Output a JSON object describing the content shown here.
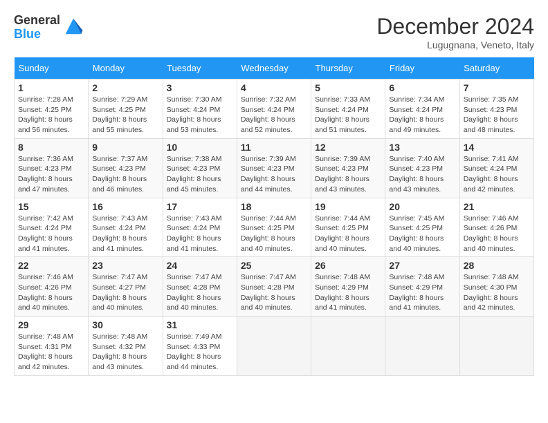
{
  "header": {
    "logo_line1": "General",
    "logo_line2": "Blue",
    "month_title": "December 2024",
    "location": "Lugugnana, Veneto, Italy"
  },
  "columns": [
    "Sunday",
    "Monday",
    "Tuesday",
    "Wednesday",
    "Thursday",
    "Friday",
    "Saturday"
  ],
  "weeks": [
    [
      {
        "day": "1",
        "info": "Sunrise: 7:28 AM\nSunset: 4:25 PM\nDaylight: 8 hours\nand 56 minutes."
      },
      {
        "day": "2",
        "info": "Sunrise: 7:29 AM\nSunset: 4:25 PM\nDaylight: 8 hours\nand 55 minutes."
      },
      {
        "day": "3",
        "info": "Sunrise: 7:30 AM\nSunset: 4:24 PM\nDaylight: 8 hours\nand 53 minutes."
      },
      {
        "day": "4",
        "info": "Sunrise: 7:32 AM\nSunset: 4:24 PM\nDaylight: 8 hours\nand 52 minutes."
      },
      {
        "day": "5",
        "info": "Sunrise: 7:33 AM\nSunset: 4:24 PM\nDaylight: 8 hours\nand 51 minutes."
      },
      {
        "day": "6",
        "info": "Sunrise: 7:34 AM\nSunset: 4:24 PM\nDaylight: 8 hours\nand 49 minutes."
      },
      {
        "day": "7",
        "info": "Sunrise: 7:35 AM\nSunset: 4:23 PM\nDaylight: 8 hours\nand 48 minutes."
      }
    ],
    [
      {
        "day": "8",
        "info": "Sunrise: 7:36 AM\nSunset: 4:23 PM\nDaylight: 8 hours\nand 47 minutes."
      },
      {
        "day": "9",
        "info": "Sunrise: 7:37 AM\nSunset: 4:23 PM\nDaylight: 8 hours\nand 46 minutes."
      },
      {
        "day": "10",
        "info": "Sunrise: 7:38 AM\nSunset: 4:23 PM\nDaylight: 8 hours\nand 45 minutes."
      },
      {
        "day": "11",
        "info": "Sunrise: 7:39 AM\nSunset: 4:23 PM\nDaylight: 8 hours\nand 44 minutes."
      },
      {
        "day": "12",
        "info": "Sunrise: 7:39 AM\nSunset: 4:23 PM\nDaylight: 8 hours\nand 43 minutes."
      },
      {
        "day": "13",
        "info": "Sunrise: 7:40 AM\nSunset: 4:23 PM\nDaylight: 8 hours\nand 43 minutes."
      },
      {
        "day": "14",
        "info": "Sunrise: 7:41 AM\nSunset: 4:24 PM\nDaylight: 8 hours\nand 42 minutes."
      }
    ],
    [
      {
        "day": "15",
        "info": "Sunrise: 7:42 AM\nSunset: 4:24 PM\nDaylight: 8 hours\nand 41 minutes."
      },
      {
        "day": "16",
        "info": "Sunrise: 7:43 AM\nSunset: 4:24 PM\nDaylight: 8 hours\nand 41 minutes."
      },
      {
        "day": "17",
        "info": "Sunrise: 7:43 AM\nSunset: 4:24 PM\nDaylight: 8 hours\nand 41 minutes."
      },
      {
        "day": "18",
        "info": "Sunrise: 7:44 AM\nSunset: 4:25 PM\nDaylight: 8 hours\nand 40 minutes."
      },
      {
        "day": "19",
        "info": "Sunrise: 7:44 AM\nSunset: 4:25 PM\nDaylight: 8 hours\nand 40 minutes."
      },
      {
        "day": "20",
        "info": "Sunrise: 7:45 AM\nSunset: 4:25 PM\nDaylight: 8 hours\nand 40 minutes."
      },
      {
        "day": "21",
        "info": "Sunrise: 7:46 AM\nSunset: 4:26 PM\nDaylight: 8 hours\nand 40 minutes."
      }
    ],
    [
      {
        "day": "22",
        "info": "Sunrise: 7:46 AM\nSunset: 4:26 PM\nDaylight: 8 hours\nand 40 minutes."
      },
      {
        "day": "23",
        "info": "Sunrise: 7:47 AM\nSunset: 4:27 PM\nDaylight: 8 hours\nand 40 minutes."
      },
      {
        "day": "24",
        "info": "Sunrise: 7:47 AM\nSunset: 4:28 PM\nDaylight: 8 hours\nand 40 minutes."
      },
      {
        "day": "25",
        "info": "Sunrise: 7:47 AM\nSunset: 4:28 PM\nDaylight: 8 hours\nand 40 minutes."
      },
      {
        "day": "26",
        "info": "Sunrise: 7:48 AM\nSunset: 4:29 PM\nDaylight: 8 hours\nand 41 minutes."
      },
      {
        "day": "27",
        "info": "Sunrise: 7:48 AM\nSunset: 4:29 PM\nDaylight: 8 hours\nand 41 minutes."
      },
      {
        "day": "28",
        "info": "Sunrise: 7:48 AM\nSunset: 4:30 PM\nDaylight: 8 hours\nand 42 minutes."
      }
    ],
    [
      {
        "day": "29",
        "info": "Sunrise: 7:48 AM\nSunset: 4:31 PM\nDaylight: 8 hours\nand 42 minutes."
      },
      {
        "day": "30",
        "info": "Sunrise: 7:48 AM\nSunset: 4:32 PM\nDaylight: 8 hours\nand 43 minutes."
      },
      {
        "day": "31",
        "info": "Sunrise: 7:49 AM\nSunset: 4:33 PM\nDaylight: 8 hours\nand 44 minutes."
      },
      {
        "day": "",
        "info": ""
      },
      {
        "day": "",
        "info": ""
      },
      {
        "day": "",
        "info": ""
      },
      {
        "day": "",
        "info": ""
      }
    ]
  ]
}
